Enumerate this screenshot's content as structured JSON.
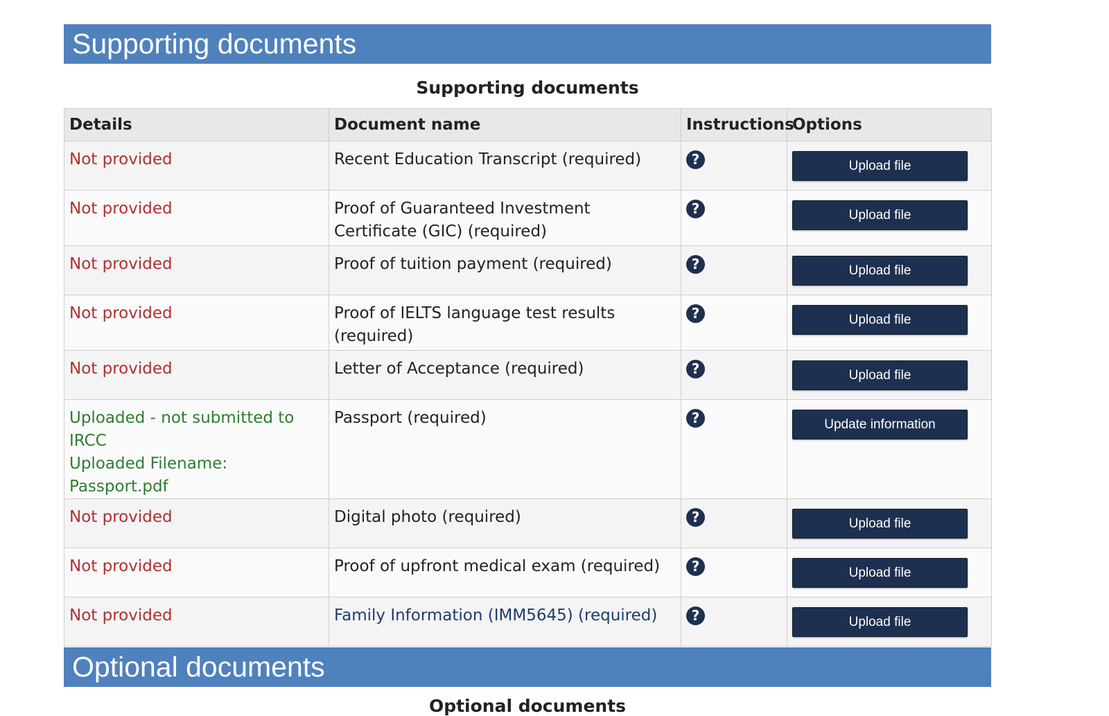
{
  "supporting_section": {
    "banner_title": "Supporting documents",
    "caption": "Supporting documents",
    "columns": {
      "details": "Details",
      "document_name": "Document name",
      "instructions": "Instructions",
      "options": "Options"
    },
    "rows": [
      {
        "status": "Not provided",
        "status_line2": "",
        "document": "Recent Education Transcript  (required)",
        "help_icon": "question-icon",
        "action": "Upload file"
      },
      {
        "status": "Not provided",
        "status_line2": "",
        "document": "Proof of Guaranteed Investment Certificate (GIC)  (required)",
        "help_icon": "question-icon",
        "action": "Upload file"
      },
      {
        "status": "Not provided",
        "status_line2": "",
        "document": "Proof of tuition payment  (required)",
        "help_icon": "question-icon",
        "action": "Upload file"
      },
      {
        "status": "Not provided",
        "status_line2": "",
        "document": "Proof of IELTS language test results  (required)",
        "help_icon": "question-icon",
        "action": "Upload file"
      },
      {
        "status": "Not provided",
        "status_line2": "",
        "document": "Letter of Acceptance  (required)",
        "help_icon": "question-icon",
        "action": "Upload file"
      },
      {
        "status": "Uploaded - not submitted to IRCC",
        "status_line2": "Uploaded Filename:  Passport.pdf",
        "document": "Passport  (required)",
        "help_icon": "question-icon",
        "action": "Update information"
      },
      {
        "status": "Not provided",
        "status_line2": "",
        "document": "Digital photo  (required)",
        "help_icon": "question-icon",
        "action": "Upload file"
      },
      {
        "status": "Not provided",
        "status_line2": "",
        "document": "Proof of upfront medical exam  (required)",
        "help_icon": "question-icon",
        "action": "Upload file"
      },
      {
        "status": "Not provided",
        "status_line2": "",
        "document": "Family Information (IMM5645)  (required)",
        "help_icon": "question-icon",
        "action": "Upload file"
      }
    ]
  },
  "optional_section": {
    "banner_title": "Optional documents",
    "caption": "Optional documents"
  },
  "help_glyph": "?",
  "colors": {
    "banner": "#4f81bd",
    "button": "#1e3050",
    "status_missing": "#b03030",
    "status_uploaded": "#2e7d32",
    "link": "#1f3c6b"
  }
}
